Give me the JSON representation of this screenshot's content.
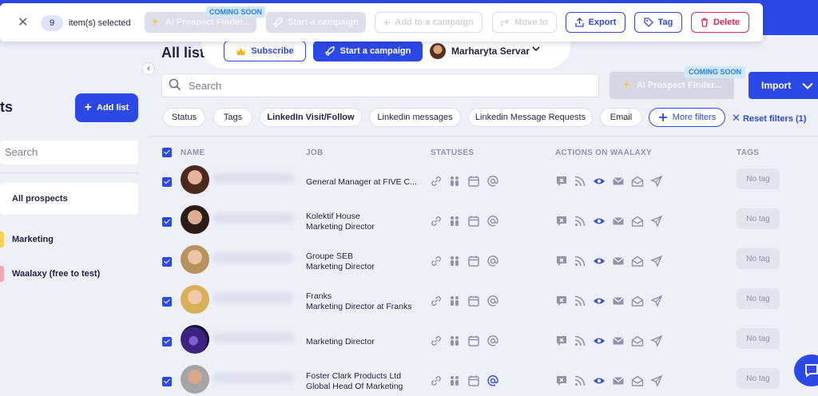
{
  "selection_bar": {
    "count": "9",
    "label": "item(s) selected",
    "ai_finder": "AI Prospect Finder...",
    "coming_soon": "COMING SOON",
    "start_campaign": "Start a campaign",
    "add_to_campaign": "Add to a campaign",
    "move_to": "Move to",
    "export": "Export",
    "tag": "Tag",
    "delete": "Delete"
  },
  "header": {
    "page_title": "All list",
    "subscribe": "Subscribe",
    "start_campaign": "Start a campaign",
    "user_name": "Marharyta Servar"
  },
  "sidebar": {
    "title": "ts",
    "add_list": "Add list",
    "search_placeholder": "Search",
    "items": [
      {
        "label": "All prospects"
      },
      {
        "label": "Marketing",
        "color": "#f7d154"
      },
      {
        "label": "Waalaxy (free to test)",
        "color": "#f3a6b8"
      }
    ]
  },
  "search": {
    "placeholder": "Search",
    "ai_finder": "AI Prospect Finder...",
    "coming_soon": "COMING SOON",
    "import": "Import"
  },
  "filters": {
    "chips": [
      "Status",
      "Tags",
      "LinkedIn Visit/Follow",
      "Linkedin messages",
      "Linkedin Message Requests",
      "Email"
    ],
    "more_filters": "More filters",
    "reset_filters": "Reset filters (1)"
  },
  "table": {
    "headers": {
      "name": "NAME",
      "job": "JOB",
      "statuses": "STATUSES",
      "actions": "ACTIONS ON WAALAXY",
      "tags": "TAGS"
    },
    "rows": [
      {
        "job_line1": "General Manager at FIVE C...",
        "job_line2": "",
        "tag": "No tag"
      },
      {
        "job_line1": "Kolektif House",
        "job_line2": "Marketing Director",
        "tag": "No tag"
      },
      {
        "job_line1": "Groupe SEB",
        "job_line2": "Marketing Director",
        "tag": "No tag"
      },
      {
        "job_line1": "Franks",
        "job_line2": "Marketing Director at Franks",
        "tag": "No tag"
      },
      {
        "job_line1": "Marketing Director",
        "job_line2": "",
        "tag": "No tag"
      },
      {
        "job_line1": "Foster Clark Products Ltd",
        "job_line2": "Global Head Of Marketing",
        "tag": "No tag"
      }
    ]
  },
  "colors": {
    "primary": "#2c48e6",
    "danger": "#e0264f",
    "muted_icon": "#8f93ad"
  },
  "icons": [
    "close-icon",
    "sparkle-icon",
    "rocket-icon",
    "plus-icon",
    "arrow-move-icon",
    "export-icon",
    "tag-icon",
    "trash-icon",
    "crown-icon",
    "chevron-down-icon",
    "search-icon",
    "link-icon",
    "people-icon",
    "calendar-icon",
    "at-icon",
    "linkedin-message-icon",
    "rss-icon",
    "eye-icon",
    "envelope-icon",
    "envelope-open-icon",
    "send-icon",
    "chat-icon"
  ]
}
